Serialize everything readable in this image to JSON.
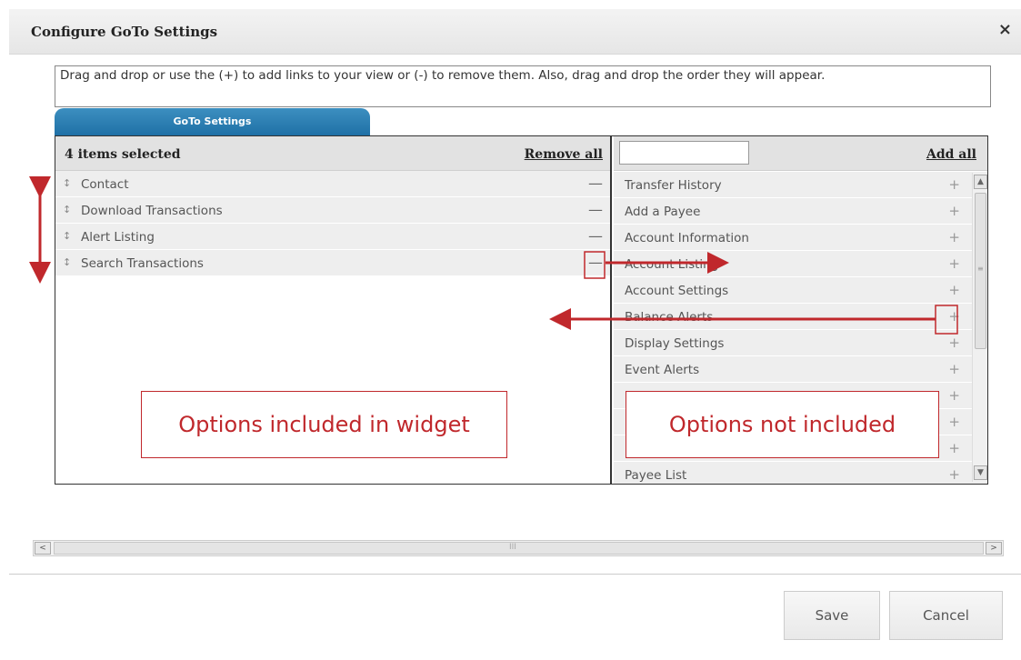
{
  "dialog": {
    "title": "Configure GoTo Settings",
    "close_icon": "×",
    "instruction": "Drag and drop or use the (+) to add links to your view or (-) to remove them. Also, drag and drop the order they will appear."
  },
  "tab": {
    "label": "GoTo Settings"
  },
  "left_panel": {
    "count_label": "4 items selected",
    "remove_all": "Remove all",
    "items": [
      {
        "label": "Contact"
      },
      {
        "label": "Download Transactions"
      },
      {
        "label": "Alert Listing"
      },
      {
        "label": "Search Transactions"
      }
    ],
    "handle_glyph": "↕",
    "remove_glyph": "—"
  },
  "right_panel": {
    "search_value": "",
    "add_all": "Add all",
    "items": [
      {
        "label": "Transfer History"
      },
      {
        "label": "Add a Payee"
      },
      {
        "label": "Account Information"
      },
      {
        "label": "Account Listing"
      },
      {
        "label": "Account Settings"
      },
      {
        "label": "Balance Alerts"
      },
      {
        "label": "Display Settings"
      },
      {
        "label": "Event Alerts"
      },
      {
        "label": ""
      },
      {
        "label": ""
      },
      {
        "label": ""
      },
      {
        "label": "Payee List"
      }
    ],
    "add_glyph": "+"
  },
  "annotations": {
    "left": "Options included in widget",
    "right": "Options not included",
    "color": "#c0282c"
  },
  "scrollbars": {
    "up": "▲",
    "down": "▼",
    "left": "<",
    "right": ">",
    "v_grip": "≡",
    "h_grip": "III"
  },
  "footer": {
    "save": "Save",
    "cancel": "Cancel"
  },
  "colors": {
    "tab": "#2a7fb5",
    "annotation": "#c0282c"
  }
}
